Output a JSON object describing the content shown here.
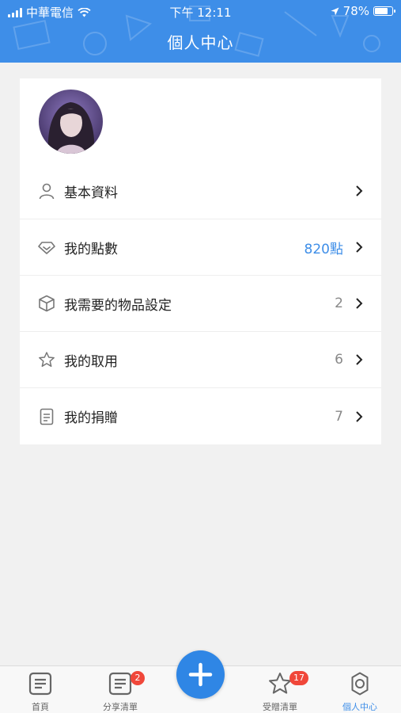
{
  "status_bar": {
    "carrier": "中華電信",
    "time": "下午 12:11",
    "battery": "78%",
    "battery_level": 0.78
  },
  "header": {
    "title": "個人中心"
  },
  "menu": [
    {
      "label": "基本資料",
      "value": "",
      "icon": "user-icon"
    },
    {
      "label": "我的點數",
      "value": "820點",
      "icon": "diamond-icon"
    },
    {
      "label": "我需要的物品設定",
      "value": "2",
      "icon": "box-icon"
    },
    {
      "label": "我的取用",
      "value": "6",
      "icon": "star-icon"
    },
    {
      "label": "我的捐贈",
      "value": "7",
      "icon": "document-icon"
    }
  ],
  "tabbar": {
    "home": "首頁",
    "share_list": "分享清單",
    "share_badge": "2",
    "received_list": "受贈清單",
    "received_badge": "17",
    "profile": "個人中心"
  },
  "colors": {
    "accent": "#3e8ee8",
    "badge": "#f0473a"
  }
}
